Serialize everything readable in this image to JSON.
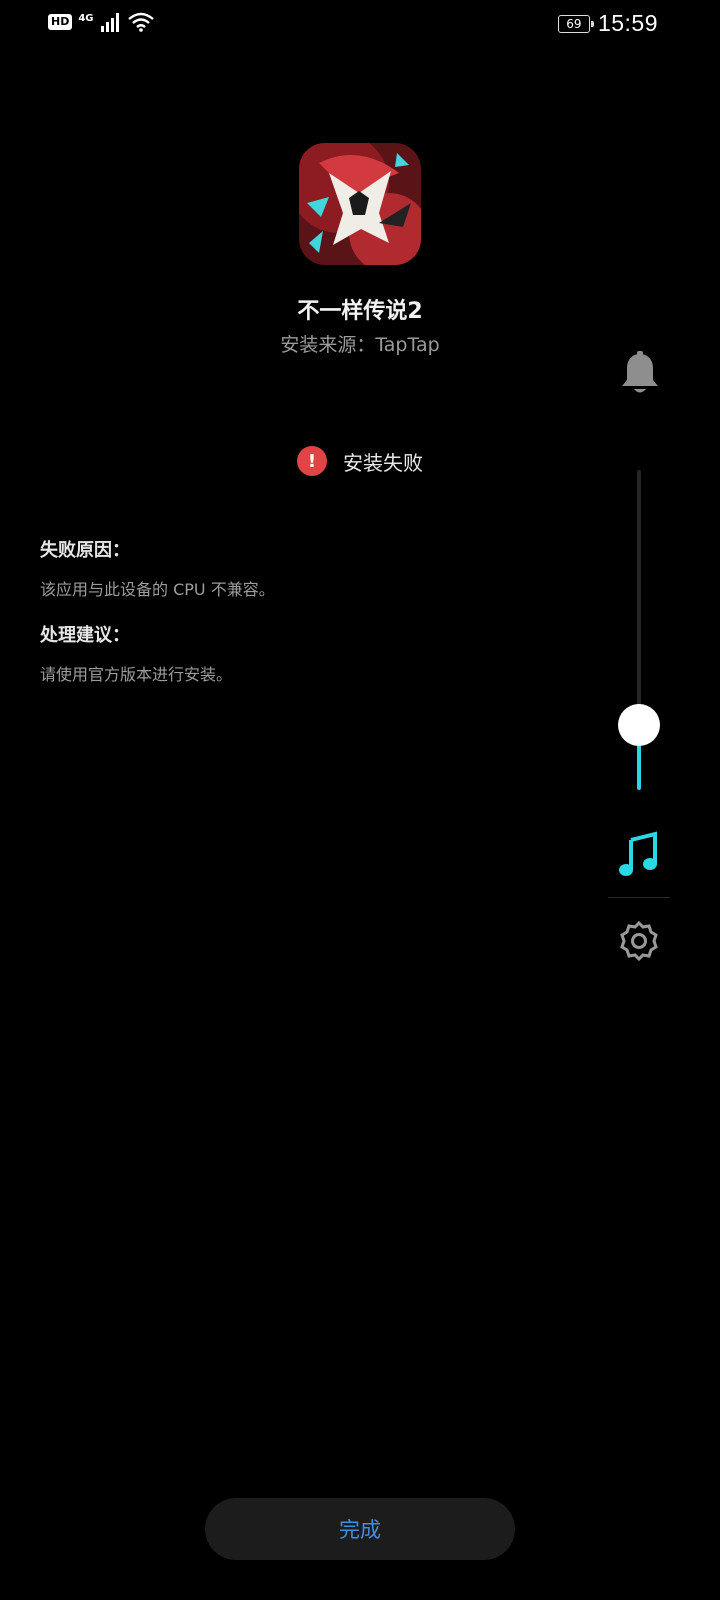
{
  "status_bar": {
    "hd_label": "HD",
    "network_label": "4G",
    "battery_level": "69",
    "time": "15:59"
  },
  "app": {
    "name": "不一样传说2",
    "install_source": "安装来源：TapTap"
  },
  "install_status": {
    "error_mark": "!",
    "text": "安装失败"
  },
  "failure_reason": {
    "title": "失败原因：",
    "body": "该应用与此设备的 CPU 不兼容。"
  },
  "suggestion": {
    "title": "处理建议：",
    "body": "请使用官方版本进行安装。"
  },
  "volume_panel": {
    "icons": [
      "bell-icon",
      "music-note-icon",
      "gear-icon"
    ],
    "level": 0.2,
    "accent_color": "#2ad8e4"
  },
  "done_button": {
    "label": "完成",
    "color": "#3d8fe6"
  },
  "colors": {
    "error_red": "#e04444",
    "background": "#000000"
  }
}
